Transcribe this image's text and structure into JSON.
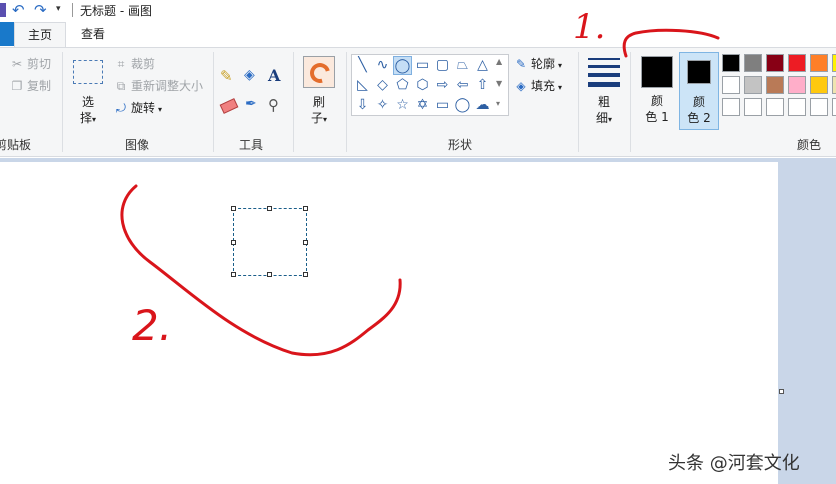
{
  "title": "无标题 - 画图",
  "tabs": [
    {
      "label": "主页"
    },
    {
      "label": "查看"
    }
  ],
  "clipboard": {
    "cut_label": "剪切",
    "copy_label": "复制",
    "group_label": "剪贴板"
  },
  "image": {
    "select_label_1": "选",
    "select_label_2": "择",
    "crop_label": "裁剪",
    "resize_label": "重新调整大小",
    "rotate_label": "旋转",
    "group_label": "图像"
  },
  "tools": {
    "text_tool_glyph": "A",
    "group_label": "工具"
  },
  "brush": {
    "label_1": "刷",
    "label_2": "子"
  },
  "shapes": {
    "outline_label": "轮廓",
    "fill_label": "填充",
    "group_label": "形状"
  },
  "size": {
    "label_1": "粗",
    "label_2": "细"
  },
  "colors": {
    "color1_label_1": "颜",
    "color1_label_2": "色 1",
    "color2_label_1": "颜",
    "color2_label_2": "色 2",
    "group_label": "颜色",
    "color1_value": "#000000",
    "color2_value": "#000000",
    "palette_row1": [
      "#000000",
      "#7f7f7f",
      "#880015",
      "#ed1c24",
      "#ff7f27",
      "#fff200"
    ],
    "palette_row2": [
      "#ffffff",
      "#c3c3c3",
      "#b97a57",
      "#ffaec9",
      "#ffc90e",
      "#efe4b0"
    ],
    "palette_row3": [
      "#ffffff",
      "#ffffff",
      "#ffffff",
      "#ffffff",
      "#ffffff",
      "#ffffff"
    ]
  },
  "annotations": {
    "mark_1": "1.",
    "mark_2": "2.",
    "stroke_color": "#d9151b"
  },
  "watermark": "头条 @河套文化",
  "accent_color": "#1979ca"
}
